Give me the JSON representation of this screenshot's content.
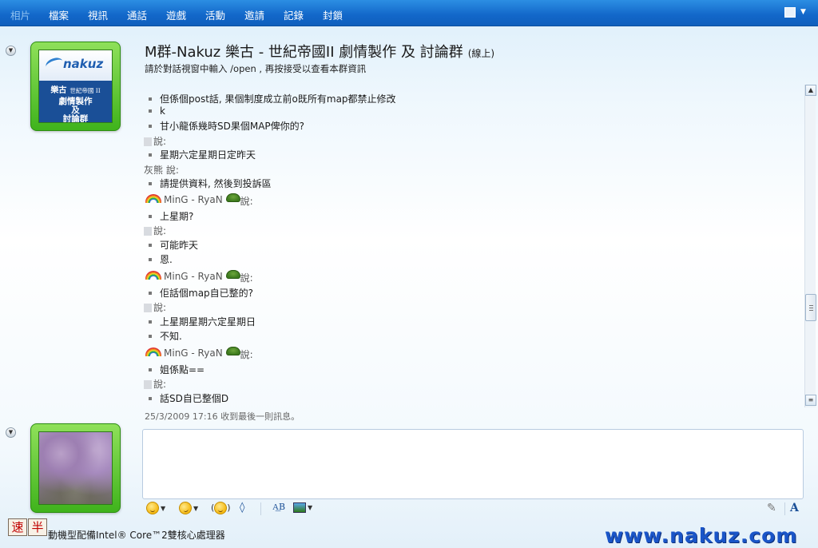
{
  "menu": {
    "items": [
      {
        "label": "相片",
        "dim": true
      },
      {
        "label": "檔案"
      },
      {
        "label": "視訊"
      },
      {
        "label": "通話"
      },
      {
        "label": "遊戲"
      },
      {
        "label": "活動"
      },
      {
        "label": "邀請"
      },
      {
        "label": "記錄"
      },
      {
        "label": "封鎖"
      }
    ]
  },
  "group_logo": {
    "brand": "nakuz",
    "band_title": "樂古",
    "band_sub": "世紀帝國 II",
    "body_line1": "劇情製作",
    "body_line2": "及",
    "body_line3": "討論群"
  },
  "header": {
    "title": "M群-Nakuz 樂古 - 世紀帝國II 劇情製作 及 討論群",
    "status": "(線上)",
    "subtitle": "請於對話視窗中輸入 /open , 再按接受以查看本群資訊"
  },
  "chat": {
    "lines": [
      {
        "kind": "msg",
        "text": "但係個post話, 果個制度成立前o既所有map都禁止修改"
      },
      {
        "kind": "msg",
        "text": "k"
      },
      {
        "kind": "msg",
        "text": "甘小龍係幾時SD果個MAP俾你的?"
      },
      {
        "kind": "name",
        "text": "說:",
        "blur": true
      },
      {
        "kind": "msg",
        "text": "星期六定星期日定昨天"
      },
      {
        "kind": "name",
        "text": "灰熊 說:"
      },
      {
        "kind": "msg",
        "text": "請提供資料, 然後到投訴區"
      },
      {
        "kind": "sender",
        "nick": "MinG - RyaN",
        "said": "說:"
      },
      {
        "kind": "msg",
        "text": "上星期?"
      },
      {
        "kind": "name",
        "text": "說:",
        "blur": true
      },
      {
        "kind": "msg",
        "text": "可能昨天"
      },
      {
        "kind": "msg",
        "text": "恩."
      },
      {
        "kind": "sender",
        "nick": "MinG - RyaN",
        "said": "說:"
      },
      {
        "kind": "msg",
        "text": "佢話個map自已整的?"
      },
      {
        "kind": "name",
        "text": "說:",
        "blur": true
      },
      {
        "kind": "msg",
        "text": "上星期星期六定星期日"
      },
      {
        "kind": "msg",
        "text": "不知."
      },
      {
        "kind": "sender",
        "nick": "MinG - RyaN",
        "said": "說:"
      },
      {
        "kind": "msg",
        "text": "姐係點=="
      },
      {
        "kind": "name",
        "text": "說:",
        "blur": true
      },
      {
        "kind": "msg",
        "text": "話SD自已整個D"
      }
    ],
    "last_received": "25/3/2009 17:16 收到最後一則訊息。"
  },
  "toolbar": {
    "font_button": "A",
    "spell_button": "A͟B"
  },
  "side_buttons": [
    "速",
    "半"
  ],
  "status_text": "動機型配備Intel® Core™2雙核心處理器",
  "watermark": "www.nakuz.com",
  "colors": {
    "menubar": "#1267c9",
    "tile_green": "#3fb31c",
    "watermark": "#1a55c8"
  }
}
